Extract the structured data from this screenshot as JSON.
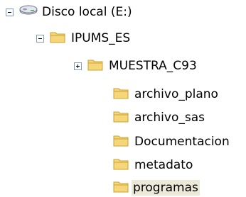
{
  "tree": {
    "drive": {
      "label": "Disco local (E:)",
      "icon": "hard-drive-icon",
      "expanded": true
    },
    "ipums": {
      "label": "IPUMS_ES",
      "icon": "folder-icon",
      "expanded": true
    },
    "muestra": {
      "label": "MUESTRA_C93",
      "icon": "folder-icon",
      "expanded": false
    },
    "children": [
      {
        "label": "archivo_plano",
        "icon": "folder-icon"
      },
      {
        "label": "archivo_sas",
        "icon": "folder-icon"
      },
      {
        "label": "Documentacion",
        "icon": "folder-icon"
      },
      {
        "label": "metadato",
        "icon": "folder-icon"
      },
      {
        "label": "programas",
        "icon": "folder-icon",
        "selected": true
      }
    ]
  },
  "colors": {
    "folder": "#f5d77a",
    "folder_edge": "#c9a031",
    "selection": "#ece9d8",
    "toggle_border": "#7f9db9"
  }
}
